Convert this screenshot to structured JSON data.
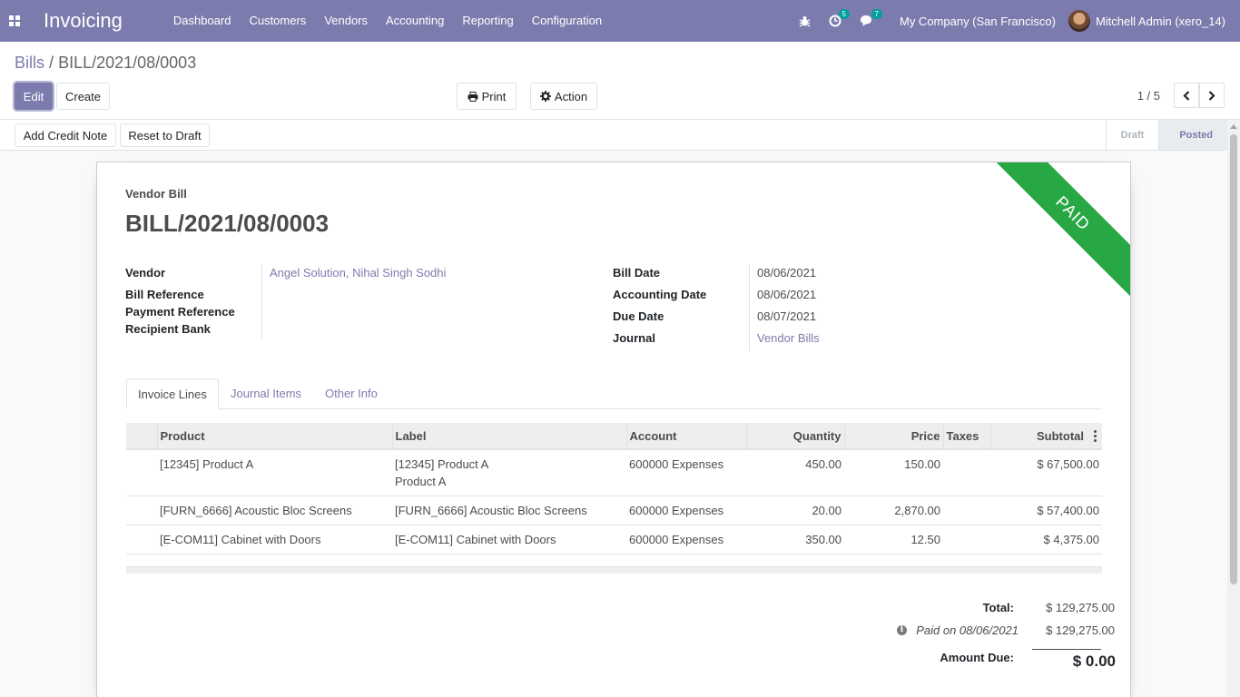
{
  "navbar": {
    "app_name": "Invoicing",
    "menu": [
      "Dashboard",
      "Customers",
      "Vendors",
      "Accounting",
      "Reporting",
      "Configuration"
    ],
    "activity_count": "5",
    "message_count": "7",
    "company": "My Company (San Francisco)",
    "user": "Mitchell Admin (xero_14)",
    "icons": [
      "apps-icon",
      "bug-icon",
      "clock-icon",
      "chat-icon"
    ]
  },
  "breadcrumb": {
    "parent": "Bills",
    "separator": "/",
    "current": "BILL/2021/08/0003"
  },
  "toolbar": {
    "edit": "Edit",
    "create": "Create",
    "print": "Print",
    "action": "Action"
  },
  "pager": {
    "value": "1 / 5"
  },
  "statusbar": {
    "add_credit_note": "Add Credit Note",
    "reset_to_draft": "Reset to Draft",
    "steps": [
      "Draft",
      "Posted"
    ],
    "active_step": "Posted"
  },
  "sheet": {
    "ribbon": "PAID",
    "doc_type": "Vendor Bill",
    "title": "BILL/2021/08/0003",
    "left_fields": {
      "vendor_label": "Vendor",
      "vendor_value": "Angel Solution, Nihal Singh Sodhi",
      "bill_reference_label": "Bill Reference",
      "payment_reference_label": "Payment Reference",
      "recipient_bank_label": "Recipient Bank"
    },
    "right_fields": {
      "bill_date_label": "Bill Date",
      "bill_date_value": "08/06/2021",
      "accounting_date_label": "Accounting Date",
      "accounting_date_value": "08/06/2021",
      "due_date_label": "Due Date",
      "due_date_value": "08/07/2021",
      "journal_label": "Journal",
      "journal_value": "Vendor Bills"
    },
    "tabs": [
      "Invoice Lines",
      "Journal Items",
      "Other Info"
    ],
    "lines": {
      "headers": {
        "product": "Product",
        "label": "Label",
        "account": "Account",
        "quantity": "Quantity",
        "price": "Price",
        "taxes": "Taxes",
        "subtotal": "Subtotal"
      },
      "rows": [
        {
          "product": "[12345] Product A",
          "label_1": "[12345] Product A",
          "label_2": "Product A",
          "account": "600000 Expenses",
          "quantity": "450.00",
          "price": "150.00",
          "taxes": "",
          "subtotal": "$ 67,500.00"
        },
        {
          "product": "[FURN_6666] Acoustic Bloc Screens",
          "label_1": "[FURN_6666] Acoustic Bloc Screens",
          "account": "600000 Expenses",
          "quantity": "20.00",
          "price": "2,870.00",
          "taxes": "",
          "subtotal": "$ 57,400.00"
        },
        {
          "product": "[E-COM11] Cabinet with Doors",
          "label_1": "[E-COM11] Cabinet with Doors",
          "account": "600000 Expenses",
          "quantity": "350.00",
          "price": "12.50",
          "taxes": "",
          "subtotal": "$ 4,375.00"
        }
      ]
    },
    "totals": {
      "total_label": "Total:",
      "total_value": "$ 129,275.00",
      "paid_label": "Paid on 08/06/2021",
      "paid_value": "$ 129,275.00",
      "amount_due_label": "Amount Due:",
      "amount_due_value": "$ 0.00"
    }
  }
}
